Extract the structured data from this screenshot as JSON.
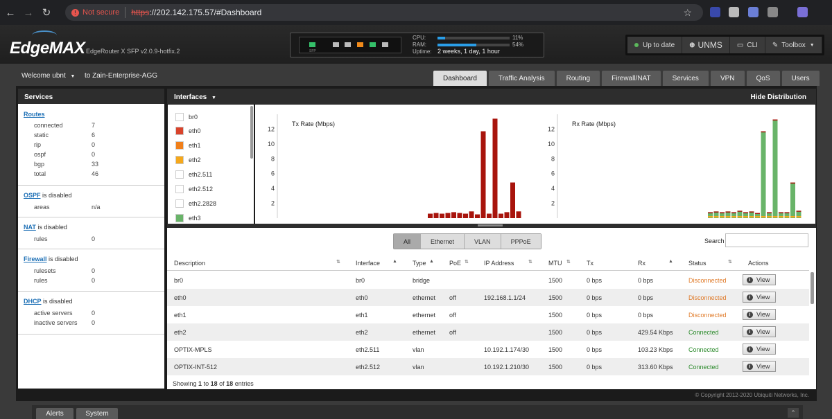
{
  "browser": {
    "security_text": "Not secure",
    "url_scheme": "https",
    "url_rest": "://202.142.175.57/#Dashboard"
  },
  "header": {
    "logo_text": "EdgeMAX",
    "model": "EdgeRouter X SFP v2.0.9-hotfix.2",
    "sfp_label": "SFP",
    "cpu_label": "CPU:",
    "cpu_value": "11%",
    "cpu_fraction": 0.11,
    "ram_label": "RAM:",
    "ram_value": "54%",
    "ram_fraction": 0.54,
    "uptime_label": "Uptime:",
    "uptime_value": "2 weeks, 1 day, 1 hour",
    "update_label": "Up to date",
    "unms_label": "UNMS",
    "cli_label": "CLI",
    "toolbox_label": "Toolbox"
  },
  "subheader": {
    "welcome": "Welcome ubnt",
    "to_host": "to Zain-Enterprise-AGG"
  },
  "tabs": [
    "Dashboard",
    "Traffic Analysis",
    "Routing",
    "Firewall/NAT",
    "Services",
    "VPN",
    "QoS",
    "Users"
  ],
  "services": {
    "title": "Services",
    "routes": {
      "link": "Routes",
      "rows": [
        {
          "label": "connected",
          "value": "7"
        },
        {
          "label": "static",
          "value": "6"
        },
        {
          "label": "rip",
          "value": "0"
        },
        {
          "label": "ospf",
          "value": "0"
        },
        {
          "label": "bgp",
          "value": "33"
        },
        {
          "label": "total",
          "value": "46"
        }
      ]
    },
    "ospf": {
      "link": "OSPF",
      "status": "is disabled",
      "rows": [
        {
          "label": "areas",
          "value": "n/a"
        }
      ]
    },
    "nat": {
      "link": "NAT",
      "status": "is disabled",
      "rows": [
        {
          "label": "rules",
          "value": "0"
        }
      ]
    },
    "firewall": {
      "link": "Firewall",
      "status": "is disabled",
      "rows": [
        {
          "label": "rulesets",
          "value": "0"
        },
        {
          "label": "rules",
          "value": "0"
        }
      ]
    },
    "dhcp": {
      "link": "DHCP",
      "status": "is disabled",
      "rows": [
        {
          "label": "active servers",
          "value": "0"
        },
        {
          "label": "inactive servers",
          "value": "0"
        }
      ]
    }
  },
  "interfaces_panel": {
    "title": "Interfaces",
    "hide_label": "Hide Distribution",
    "legend": [
      {
        "name": "br0",
        "color": "#ffffff"
      },
      {
        "name": "eth0",
        "color": "#d9432b"
      },
      {
        "name": "eth1",
        "color": "#f07f1a"
      },
      {
        "name": "eth2",
        "color": "#f5a81c"
      },
      {
        "name": "eth2.511",
        "color": "#ffffff"
      },
      {
        "name": "eth2.512",
        "color": "#ffffff"
      },
      {
        "name": "eth2.2828",
        "color": "#ffffff"
      },
      {
        "name": "eth3",
        "color": "#69b469"
      }
    ]
  },
  "chart_data": [
    {
      "type": "bar",
      "ylabel": "Tx Rate (Mbps)",
      "yticks": [
        2,
        4,
        6,
        8,
        10,
        12
      ],
      "ylim": [
        0,
        14
      ],
      "color": "#a8140c",
      "values": [
        0.6,
        0.7,
        0.6,
        0.7,
        0.8,
        0.7,
        0.6,
        0.9,
        0.5,
        11.7,
        0.6,
        13.4,
        0.6,
        0.8,
        4.8,
        0.9
      ]
    },
    {
      "type": "bar",
      "ylabel": "Rx Rate (Mbps)",
      "yticks": [
        2,
        4,
        6,
        8,
        10,
        12
      ],
      "ylim": [
        0,
        14
      ],
      "color": "#69b469",
      "values": [
        0.8,
        0.9,
        0.8,
        0.9,
        0.8,
        1.0,
        0.8,
        0.9,
        0.7,
        11.7,
        0.8,
        13.3,
        0.8,
        0.8,
        4.8,
        1.0
      ]
    }
  ],
  "table": {
    "filters": [
      "All",
      "Ethernet",
      "VLAN",
      "PPPoE"
    ],
    "search_label": "Search",
    "headers": [
      "Description",
      "Interface",
      "Type",
      "PoE",
      "IP Address",
      "MTU",
      "Tx",
      "Rx",
      "Status",
      "Actions"
    ],
    "view_label": "View",
    "rows": [
      {
        "description": "br0",
        "interface": "br0",
        "type": "bridge",
        "poe": "",
        "ip": "",
        "mtu": "1500",
        "tx": "0 bps",
        "rx": "0 bps",
        "status": "Disconnected"
      },
      {
        "description": "eth0",
        "interface": "eth0",
        "type": "ethernet",
        "poe": "off",
        "ip": "192.168.1.1/24",
        "mtu": "1500",
        "tx": "0 bps",
        "rx": "0 bps",
        "status": "Disconnected"
      },
      {
        "description": "eth1",
        "interface": "eth1",
        "type": "ethernet",
        "poe": "off",
        "ip": "",
        "mtu": "1500",
        "tx": "0 bps",
        "rx": "0 bps",
        "status": "Disconnected"
      },
      {
        "description": "eth2",
        "interface": "eth2",
        "type": "ethernet",
        "poe": "off",
        "ip": "",
        "mtu": "1500",
        "tx": "0 bps",
        "rx": "429.54 Kbps",
        "status": "Connected"
      },
      {
        "description": "OPTIX-MPLS",
        "interface": "eth2.511",
        "type": "vlan",
        "poe": "",
        "ip": "10.192.1.174/30",
        "mtu": "1500",
        "tx": "0 bps",
        "rx": "103.23 Kbps",
        "status": "Connected"
      },
      {
        "description": "OPTIX-INT-512",
        "interface": "eth2.512",
        "type": "vlan",
        "poe": "",
        "ip": "10.192.1.210/30",
        "mtu": "1500",
        "tx": "0 bps",
        "rx": "313.60 Kbps",
        "status": "Connected"
      }
    ],
    "showing": {
      "prefix": "Showing",
      "from": "1",
      "to_word": "to",
      "to": "18",
      "of_word": "of",
      "total": "18",
      "suffix": "entries"
    }
  },
  "footer": {
    "copyright": "© Copyright 2012-2020 Ubiquiti Networks, Inc.",
    "bottom_tabs": [
      "Alerts",
      "System"
    ]
  }
}
